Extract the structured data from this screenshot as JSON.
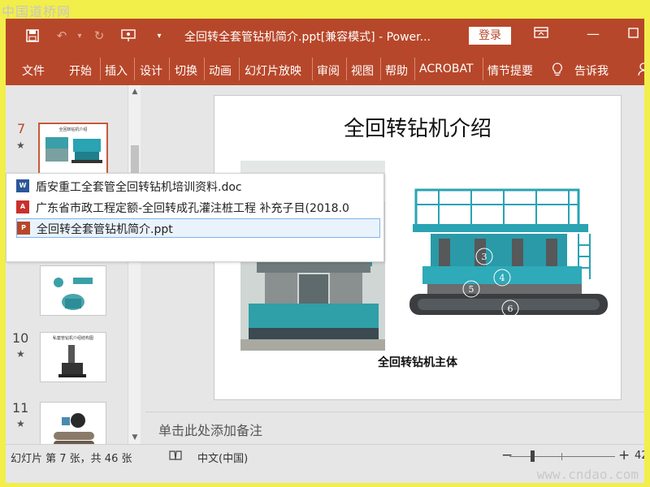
{
  "watermark": {
    "top": "中国道桥网",
    "bottom": "www.cndao.com"
  },
  "titlebar": {
    "title": "全回转全套管钻机简介.ppt[兼容模式] - Power...",
    "login": "登录"
  },
  "ribbon": {
    "tabs": [
      "文件",
      "开始",
      "插入",
      "设计",
      "切换",
      "动画",
      "幻灯片放映",
      "审阅",
      "视图",
      "帮助",
      "ACROBAT",
      "情节提要"
    ],
    "tell_me": "告诉我"
  },
  "thumbnails": [
    {
      "number": "7",
      "title": "全回转钻机介绍",
      "active": true
    },
    {
      "number": "10",
      "title": "私套管钻机介绍结构图",
      "active": false
    },
    {
      "number": "11",
      "title": "",
      "active": false
    }
  ],
  "slide": {
    "title": "全回转钻机介绍",
    "caption": "全回转钻机主体",
    "labels": [
      "3",
      "4",
      "5",
      "6"
    ]
  },
  "notes": {
    "placeholder": "单击此处添加备注"
  },
  "statusbar": {
    "slide_info": "幻灯片 第 7 张，共 46 张",
    "language": "中文(中国)",
    "zoom_minus": "−",
    "zoom_plus": "+",
    "zoom_value": "42"
  },
  "popup": {
    "items": [
      {
        "type": "doc",
        "label": "盾安重工全套管全回转钻机培训资料.doc"
      },
      {
        "type": "pdf",
        "label": "广东省市政工程定额-全回转成孔灌注桩工程 补充子目(2018.0"
      },
      {
        "type": "ppt",
        "label": "全回转全套管钻机简介.ppt",
        "selected": true
      }
    ]
  },
  "colors": {
    "accent": "#b7472a",
    "teal": "#2aa3b3",
    "popup_select": "#eaf3fc"
  }
}
